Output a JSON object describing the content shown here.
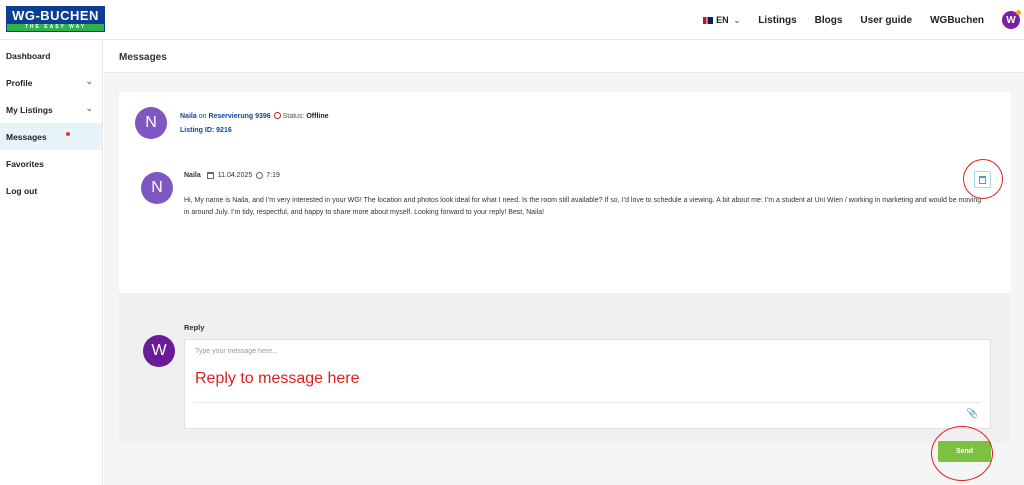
{
  "brand": {
    "logo_top": "WG-BUCHEN",
    "logo_bottom": "THE EASY WAY"
  },
  "nav": {
    "language": "EN",
    "links": [
      "Listings",
      "Blogs",
      "User guide",
      "WGBuchen"
    ],
    "avatar_initial": "W"
  },
  "sidebar": {
    "items": [
      {
        "label": "Dashboard"
      },
      {
        "label": "Profile"
      },
      {
        "label": "My Listings"
      },
      {
        "label": "Messages"
      },
      {
        "label": "Favorites"
      },
      {
        "label": "Log out"
      }
    ]
  },
  "page": {
    "title": "Messages"
  },
  "conversation": {
    "avatar_initial": "N",
    "sender": "Naila",
    "on_text": "on",
    "listing_title": "Reservierung 9396",
    "status_label": "Status:",
    "status_value": "Offline",
    "listing_id": "Listing ID: 9216"
  },
  "message": {
    "avatar_initial": "N",
    "sender": "Naila",
    "date": "11.04.2025",
    "time": "7:19",
    "text": "Hi, My name is Naila, and I’m very interested in your WG! The location and photos look ideal for what I need. Is the room still available? If so, I’d love to schedule a viewing. A bit about me: I’m a student at Uni Wien / working in marketing and would be moving in around July. I’m tidy, respectful, and happy to share more about myself. Looking forward to your reply! Best, Naila!"
  },
  "reply": {
    "label": "Reply",
    "avatar_initial": "W",
    "placeholder": "Type your message here...",
    "annotation": "Reply to message here",
    "send_label": "Send"
  },
  "colors": {
    "brand_blue": "#0b3d91",
    "brand_green": "#2fb24a",
    "annotation_red": "#e02020",
    "send_green": "#7cc142",
    "avatar_purple": "#7e57c2"
  }
}
